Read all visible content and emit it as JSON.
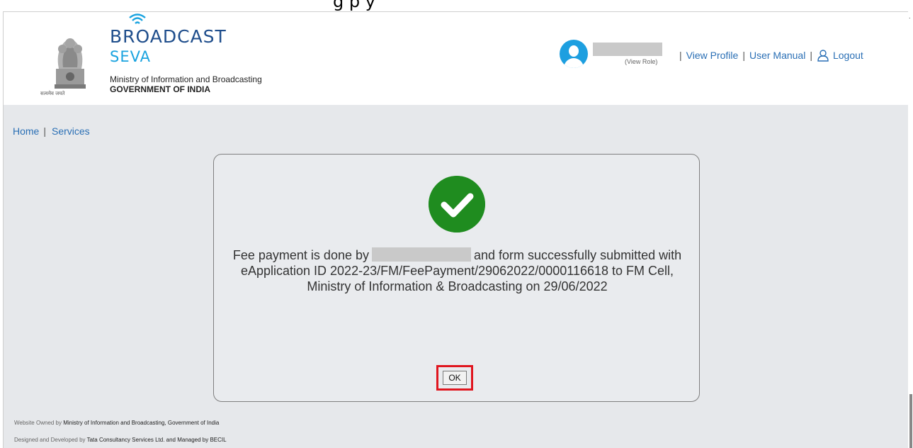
{
  "caption": "g                       p  y",
  "brand": {
    "line1": "BROADCAST",
    "line2": "SEVA",
    "ministry": "Ministry of Information and Broadcasting",
    "government": "GOVERNMENT OF INDIA",
    "emblem_caption": "सत्यमेव जयते"
  },
  "user": {
    "view_role": "(View Role)",
    "links": {
      "view_profile": "View Profile",
      "user_manual": "User Manual",
      "logout": "Logout",
      "separator": "|"
    }
  },
  "breadcrumb": {
    "home": "Home",
    "services": "Services",
    "separator": "|"
  },
  "modal": {
    "message_part1": "Fee payment is done by",
    "message_part2": "and form successfully submitted with",
    "message_line2": "eApplication ID 2022-23/FM/FeePayment/29062022/0000116618 to FM Cell,",
    "message_line3": "Ministry of Information & Broadcasting on 29/06/2022",
    "ok_label": "OK",
    "check_color": "#1f8c1f",
    "highlight_color": "#e0161f"
  },
  "footer": {
    "owned_prefix": "Website Owned by",
    "owned_by": "Ministry of Information and Broadcasting, Government of India",
    "designed_prefix": "Designed and Developed by",
    "designed_by": "Tata Consultancy Services Ltd. and Managed by BECIL"
  },
  "colors": {
    "link": "#2a6fb5",
    "brand_dark": "#1f4e8c",
    "brand_light": "#1aa3df",
    "page_bg": "#e6e8eb"
  }
}
